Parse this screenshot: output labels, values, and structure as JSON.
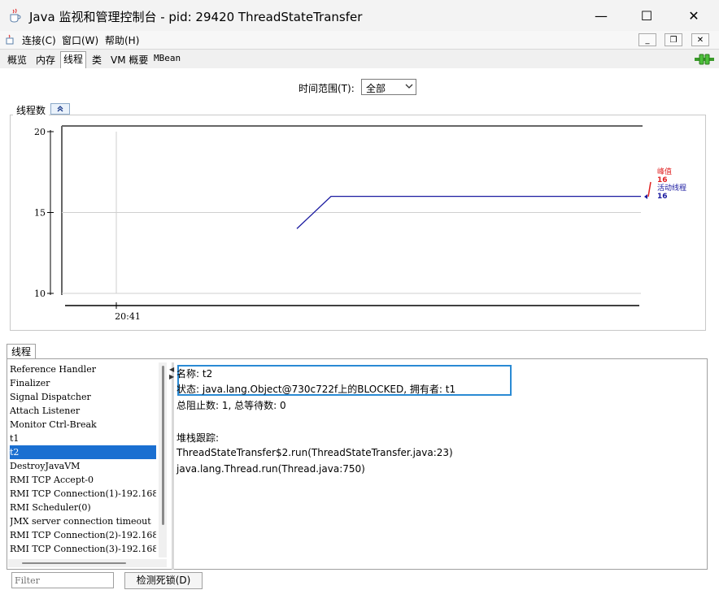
{
  "window": {
    "title": "Java 监视和管理控制台 - pid: 29420 ThreadStateTransfer",
    "minimize": "—",
    "maximize": "☐",
    "close": "✕"
  },
  "menu": [
    "连接(C)",
    "窗口(W)",
    "帮助(H)"
  ],
  "mdi": {
    "minimize": "_",
    "restore": "❐",
    "close": "✕"
  },
  "tabs": [
    "概览",
    "内存",
    "线程",
    "类",
    "VM 概要",
    "MBean"
  ],
  "time_range": {
    "label": "时间范围(T):",
    "value": "全部"
  },
  "chart": {
    "title": "线程数",
    "legend_peak_label": "峰值",
    "legend_peak_value": "16",
    "legend_live_label": "活动线程",
    "legend_live_value": "16",
    "peak_color": "#e02020",
    "live_color": "#1a1aa0"
  },
  "chart_data": {
    "type": "line",
    "title": "线程数",
    "xlabel": "",
    "ylabel": "",
    "ylim": [
      10,
      20
    ],
    "yticks": [
      "20",
      "15",
      "10"
    ],
    "xticks": [
      "20:41"
    ],
    "series": [
      {
        "name": "活动线程",
        "x": [
          0.5,
          1.0,
          1.4,
          1.9,
          2.4,
          2.9,
          3.4,
          3.9,
          4.4,
          4.9,
          5.4,
          5.9,
          6.4,
          6.9,
          7.4,
          7.9,
          8.4,
          8.9,
          9.4,
          9.9,
          10.4,
          10.9,
          11.4,
          11.9
        ],
        "values": [
          14,
          16,
          16,
          16,
          16,
          16,
          16,
          16,
          16,
          16,
          16,
          16,
          16,
          16,
          16,
          16,
          16,
          16,
          16,
          16,
          16,
          16,
          16,
          16
        ]
      }
    ]
  },
  "threads": {
    "section_label": "线程",
    "items": [
      "Reference Handler",
      "Finalizer",
      "Signal Dispatcher",
      "Attach Listener",
      "Monitor Ctrl-Break",
      "t1",
      "t2",
      "DestroyJavaVM",
      "RMI TCP Accept-0",
      "RMI TCP Connection(1)-192.168.",
      "RMI Scheduler(0)",
      "JMX server connection timeout",
      "RMI TCP Connection(2)-192.168.",
      "RMI TCP Connection(3)-192.168."
    ],
    "selected_index": 6,
    "detail": {
      "name_line": "名称: t2",
      "state_line": "状态: java.lang.Object@730c722f上的BLOCKED, 拥有者: t1",
      "totals_line": "总阻止数: 1, 总等待数: 0",
      "stack_label": "堆栈跟踪:",
      "stack": [
        "ThreadStateTransfer$2.run(ThreadStateTransfer.java:23)",
        "java.lang.Thread.run(Thread.java:750)"
      ]
    },
    "filter_placeholder": "Filter",
    "detect_deadlock": "检测死锁(D)"
  },
  "colors": {
    "highlight_box": "#2a8ad4",
    "selection": "#1a6fd1",
    "tab_active": "#ffffff"
  }
}
